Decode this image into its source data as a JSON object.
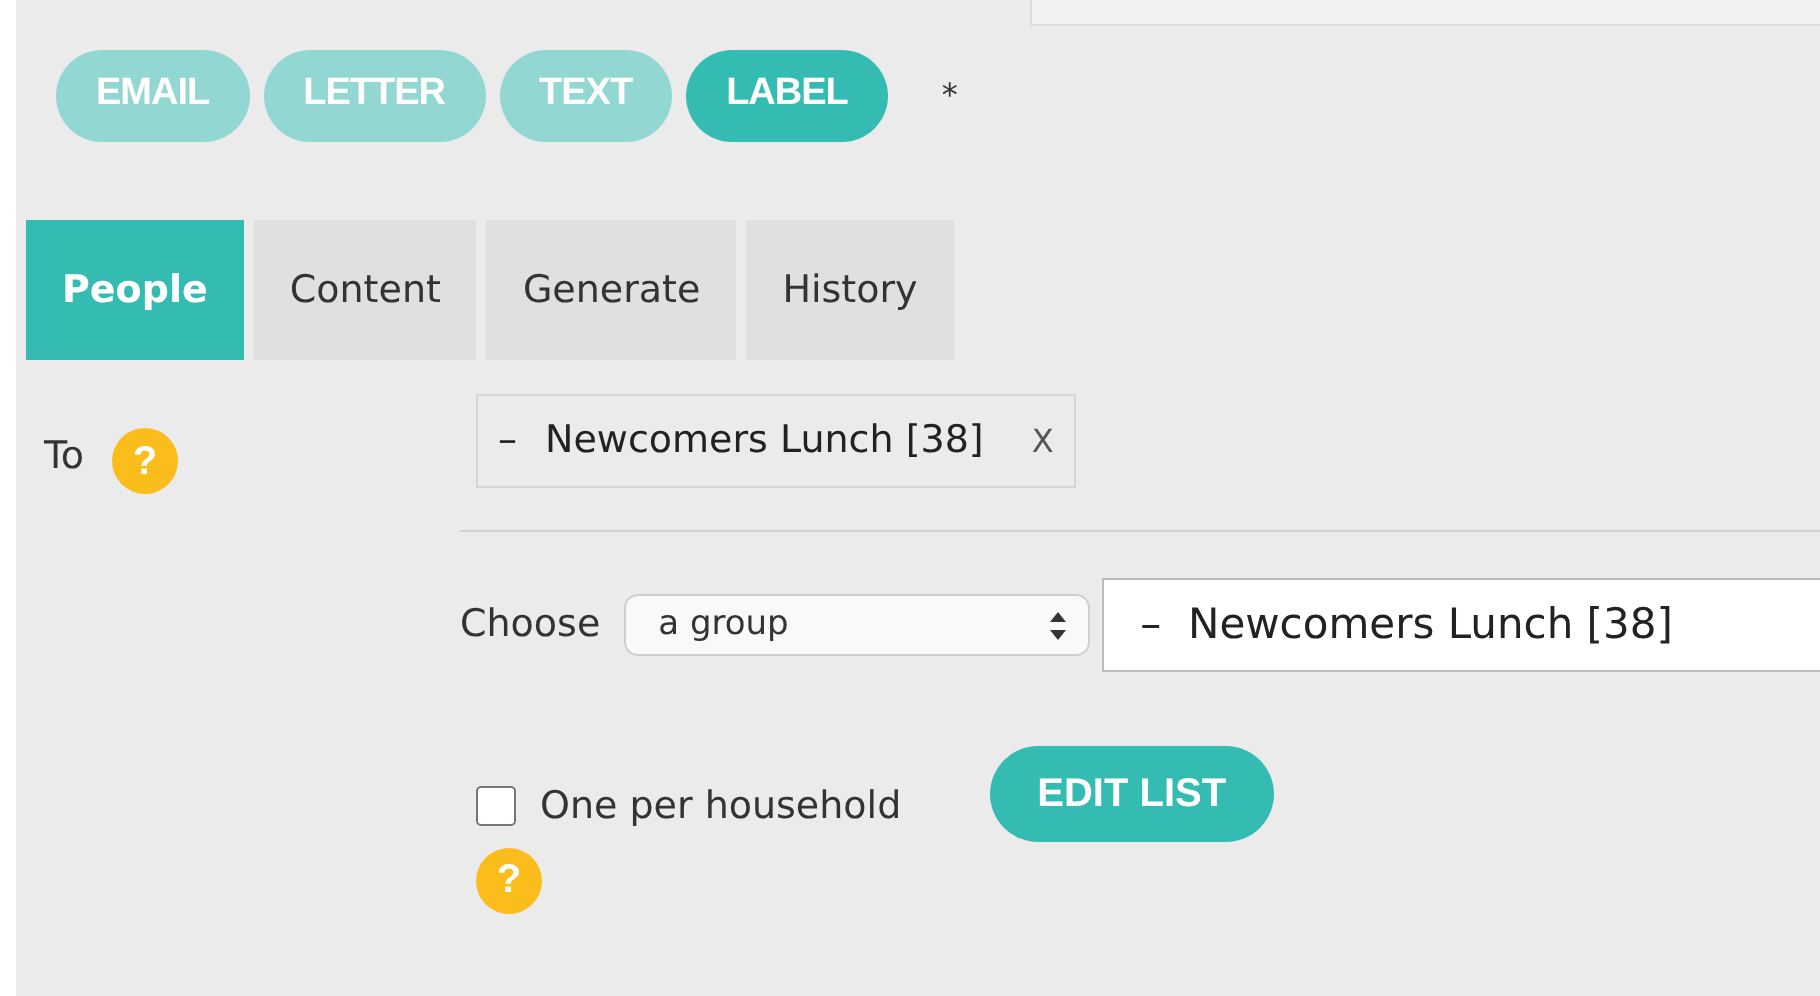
{
  "modes": [
    {
      "label": "EMAIL",
      "selected": false
    },
    {
      "label": "LETTER",
      "selected": false
    },
    {
      "label": "TEXT",
      "selected": false
    },
    {
      "label": "LABEL",
      "selected": true
    }
  ],
  "required_mark": "*",
  "tabs": [
    {
      "label": "People",
      "selected": true
    },
    {
      "label": "Content",
      "selected": false
    },
    {
      "label": "Generate",
      "selected": false
    },
    {
      "label": "History",
      "selected": false
    }
  ],
  "to": {
    "label": "To",
    "help": "?",
    "tokens": [
      {
        "dash": "–",
        "text": "Newcomers Lunch [38]",
        "remove": "X"
      }
    ]
  },
  "choose": {
    "label": "Choose",
    "select_value": "a group",
    "input_value": "–  Newcomers Lunch [38]"
  },
  "one_per_household": {
    "label": "One per household",
    "checked": false,
    "help": "?"
  },
  "edit_button": "EDIT LIST"
}
